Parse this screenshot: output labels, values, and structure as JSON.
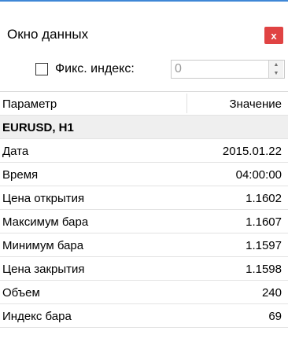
{
  "window": {
    "title": "Окно данных",
    "close_label": "x"
  },
  "toolbar": {
    "fix_index_label": "Фикс. индекс:",
    "index_value": "0",
    "fix_index_checked": false
  },
  "table": {
    "columns": [
      "Параметр",
      "Значение"
    ],
    "group": "EURUSD, H1",
    "rows": [
      {
        "param": "Дата",
        "value": "2015.01.22"
      },
      {
        "param": "Время",
        "value": "04:00:00"
      },
      {
        "param": "Цена открытия",
        "value": "1.1602"
      },
      {
        "param": "Максимум бара",
        "value": "1.1607"
      },
      {
        "param": "Минимум бара",
        "value": "1.1597"
      },
      {
        "param": "Цена закрытия",
        "value": "1.1598"
      },
      {
        "param": "Объем",
        "value": "240"
      },
      {
        "param": "Индекс бара",
        "value": "69"
      }
    ]
  },
  "colors": {
    "accent": "#3f87d6",
    "close_button": "#e04343",
    "group_row_bg": "#efefef"
  }
}
